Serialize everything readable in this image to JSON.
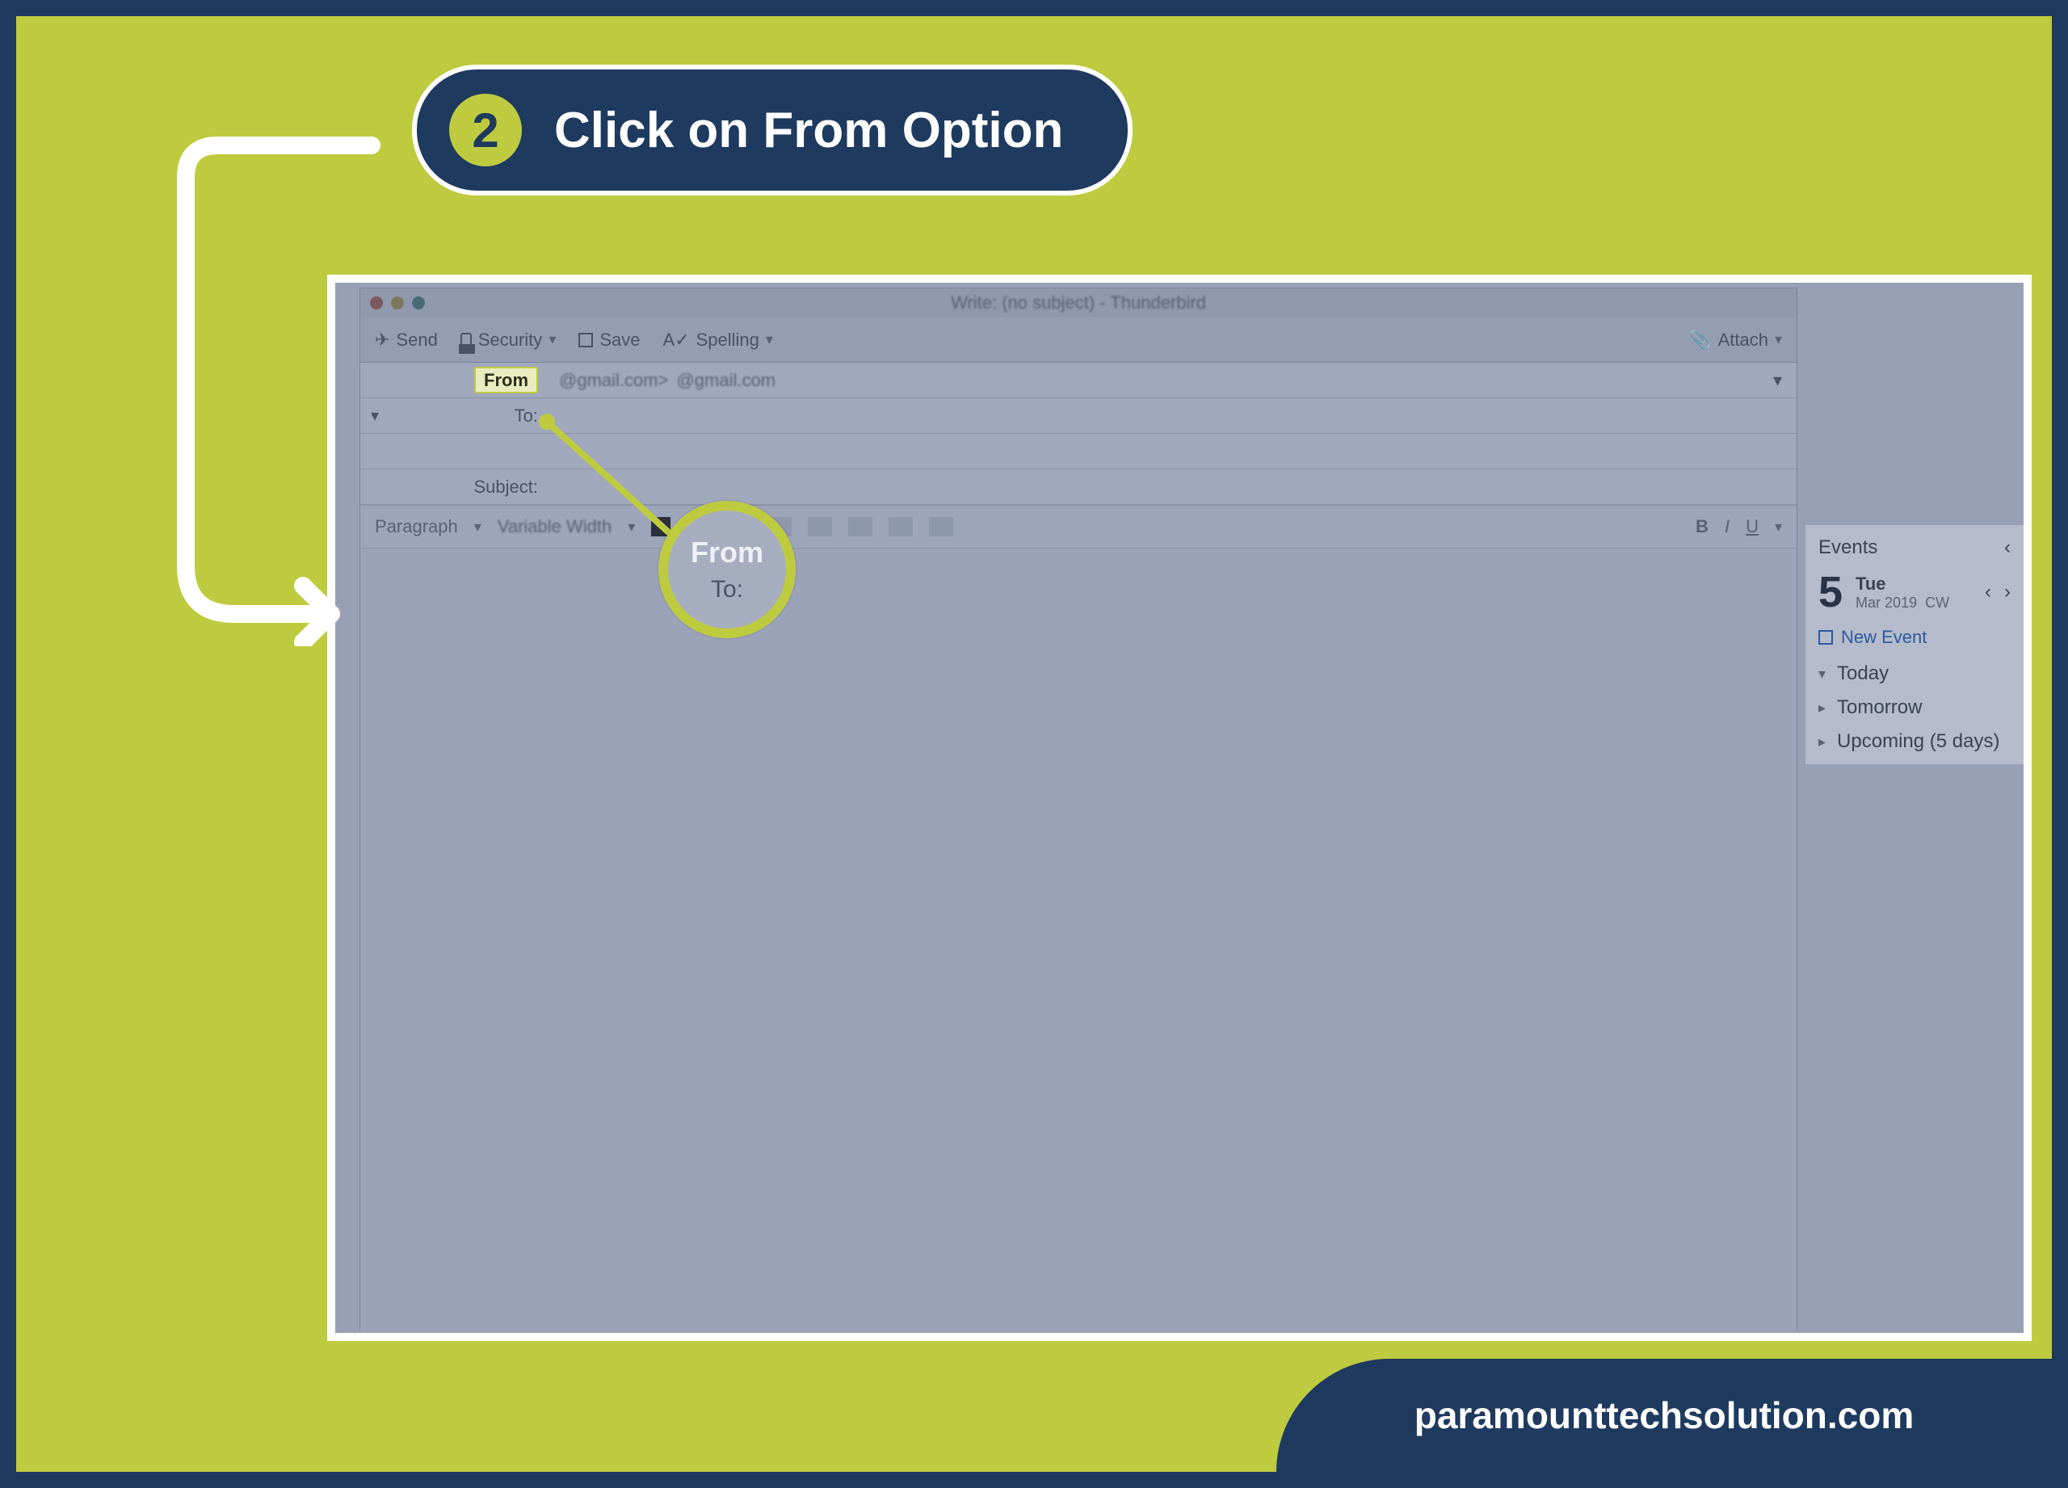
{
  "step": {
    "number": "2",
    "title": "Click on From Option"
  },
  "compose": {
    "window_title": "Write: (no subject) - Thunderbird",
    "toolbar": {
      "send": "Send",
      "security": "Security",
      "save": "Save",
      "spelling": "Spelling",
      "attach": "Attach"
    },
    "headers": {
      "from_label": "From",
      "from_value_a": "@gmail.com>",
      "from_value_b": "@gmail.com",
      "to_label": "To:",
      "subject_label": "Subject:"
    },
    "format": {
      "paragraph": "Paragraph",
      "font": "Variable Width"
    }
  },
  "magnifier": {
    "from": "From",
    "to": "To:"
  },
  "calendar": {
    "panel_title": "Events",
    "day_number": "5",
    "weekday": "Tue",
    "month_year": "Mar 2019",
    "cw": "CW",
    "new_event": "New Event",
    "items": {
      "today": "Today",
      "tomorrow": "Tomorrow",
      "upcoming": "Upcoming (5 days)"
    }
  },
  "footer": {
    "brand": "paramounttechsolution.com"
  },
  "colors": {
    "navy": "#1e3a5f",
    "lime": "#bfcb3f",
    "white": "#ffffff"
  }
}
